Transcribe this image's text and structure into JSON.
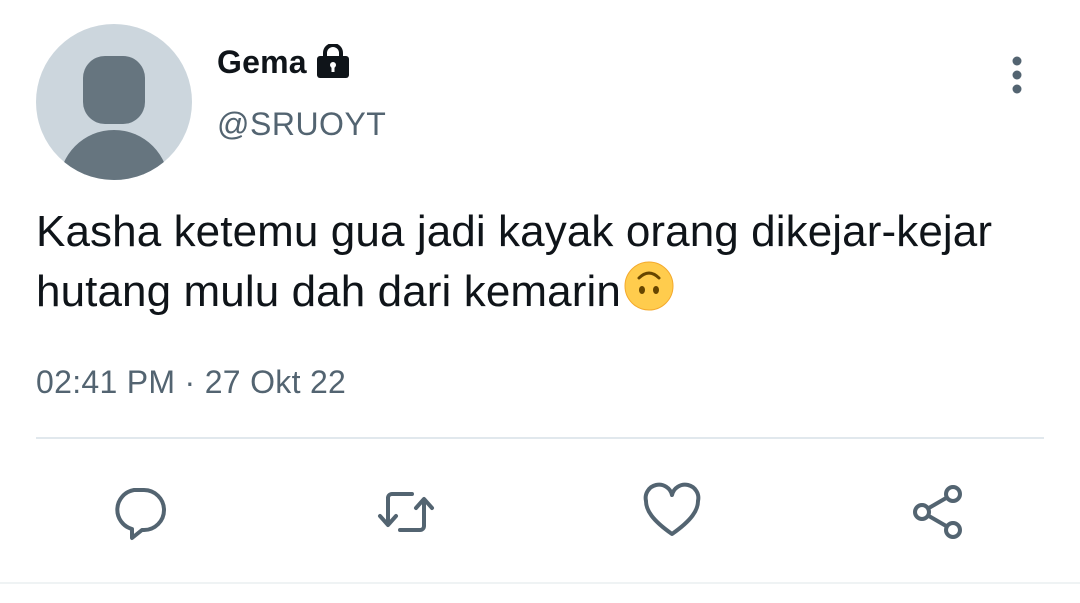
{
  "tweet": {
    "author": {
      "display_name": "Gema",
      "handle": "@SRUOYT",
      "avatar_icon": "default-avatar-icon",
      "protected_icon": "lock-icon"
    },
    "text": "Kasha ketemu gua jadi kayak orang dikejar-kejar hutang mulu dah dari kemarin",
    "text_emoji": "upside-down-face-emoji",
    "timestamp": "02:41 PM · 27 Okt 22",
    "menu_icon": "more-vertical-icon",
    "actions": [
      {
        "name": "reply",
        "icon": "reply-icon"
      },
      {
        "name": "retweet",
        "icon": "retweet-icon"
      },
      {
        "name": "like",
        "icon": "heart-icon"
      },
      {
        "name": "share",
        "icon": "share-icon"
      }
    ]
  },
  "colors": {
    "text_primary": "#0f1419",
    "text_secondary": "#536471",
    "icon": "#536471",
    "avatar_bg": "#ccd6dd",
    "avatar_fg": "#66757f",
    "divider": "#e1e8ed",
    "emoji": "#ffcc4d"
  }
}
